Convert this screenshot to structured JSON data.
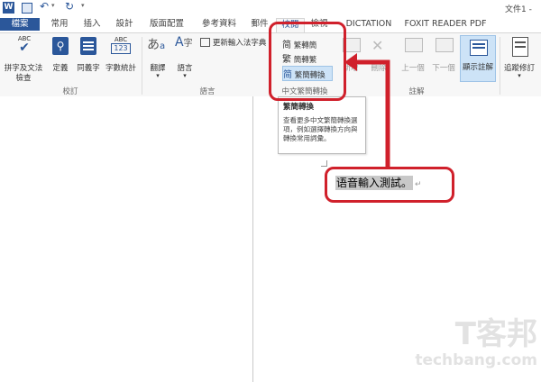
{
  "titlebar": {
    "doc_title": "文件1 - "
  },
  "tabs": [
    "檔案",
    "常用",
    "插入",
    "設計",
    "版面配置",
    "參考資料",
    "郵件",
    "校閱",
    "檢視",
    "DICTATION",
    "FOXIT READER PDF"
  ],
  "proofing": {
    "spelling_line1": "拼字及文法",
    "spelling_line2": "檢查",
    "define": "定義",
    "thesaurus": "同義字",
    "word_count": "字數統計",
    "group": "校訂"
  },
  "language": {
    "translate": "翻譯",
    "language": "語言",
    "ime_update": "更新輸入法字典",
    "group": "語言"
  },
  "chinese_conversion": {
    "items": [
      "繁轉簡",
      "簡轉繁",
      "繁簡轉換"
    ],
    "group": "中文繁簡轉換"
  },
  "comments": {
    "new_comment": "新增",
    "delete": "刪除",
    "previous": "上一個",
    "next": "下一個",
    "show_comments": "顯示註解",
    "group": "註解"
  },
  "tracking": {
    "track_changes": "追蹤修訂"
  },
  "tooltip": {
    "title": "繁簡轉換",
    "body": "查看更多中文繁簡轉換選項，例如選擇轉換方向與轉換常用詞彙。"
  },
  "document": {
    "text": "语音輸入測試。",
    "paragraph_mark": "↵"
  },
  "watermark": {
    "line1": "T客邦",
    "line2": "techbang.com"
  },
  "colors": {
    "accent": "#2b579a",
    "callout": "#d0202b"
  }
}
